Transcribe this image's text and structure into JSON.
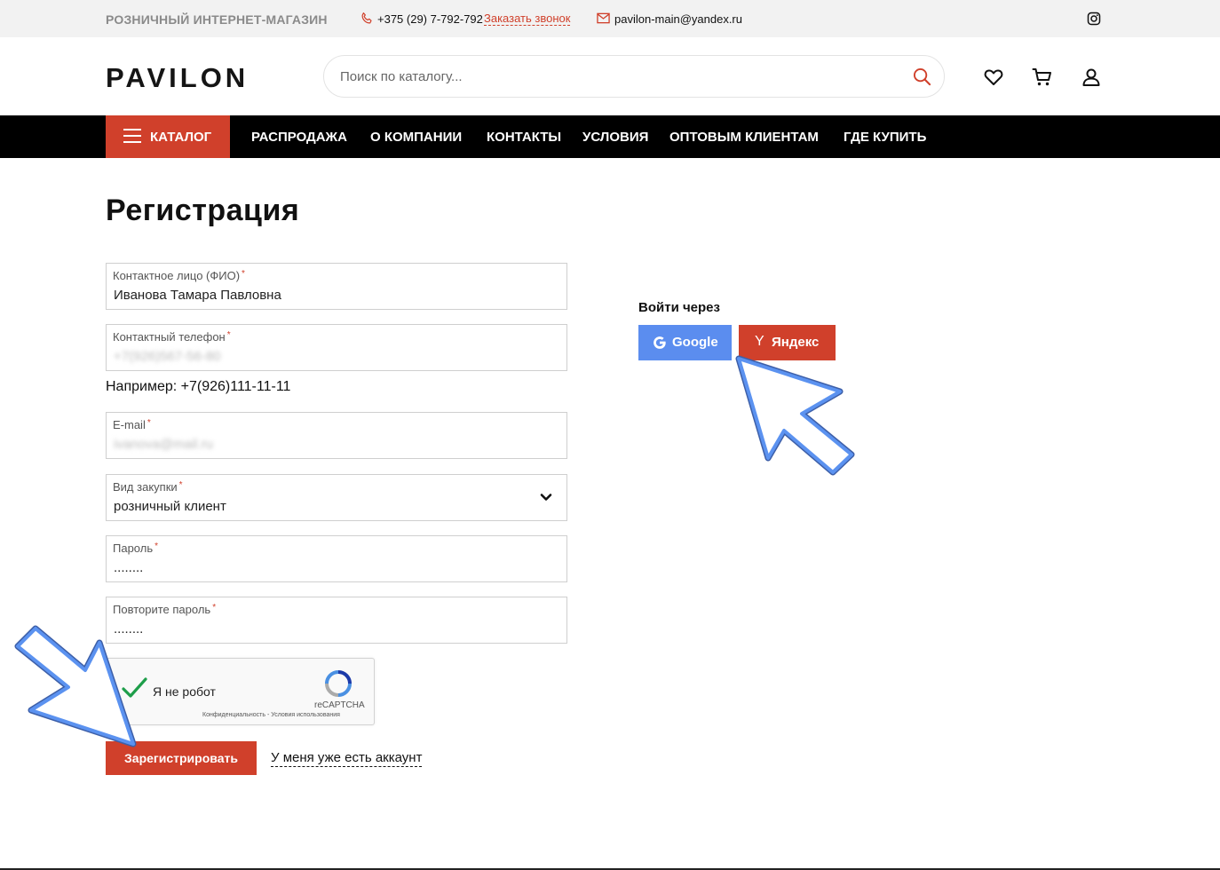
{
  "topbar": {
    "tagline": "РОЗНИЧНЫЙ ИНТЕРНЕТ-МАГАЗИН",
    "phone": "+375 (29) 7-792-792",
    "callback": "Заказать звонок",
    "email": "pavilon-main@yandex.ru",
    "social_icon": "instagram-icon"
  },
  "header": {
    "logo": "PAVILON",
    "search_placeholder": "Поиск по каталогу...",
    "icons": [
      "heart-icon",
      "cart-icon",
      "user-icon"
    ]
  },
  "nav": {
    "catalog": "КАТАЛОГ",
    "items": [
      "РАСПРОДАЖА",
      "О КОМПАНИИ",
      "КОНТАКТЫ",
      "УСЛОВИЯ",
      "ОПТОВЫМ КЛИЕНТАМ",
      "ГДЕ КУПИТЬ"
    ]
  },
  "page": {
    "title": "Регистрация"
  },
  "form": {
    "fields": [
      {
        "label": "Контактное лицо (ФИО)",
        "required": "*",
        "value": "Иванова Тамара Павловна"
      },
      {
        "label": "Контактный телефон",
        "required": "*",
        "value": "+7(926)567-56-80"
      },
      {
        "label": "E-mail",
        "required": "*",
        "value": "ivanova@mail.ru"
      },
      {
        "label": "Вид закупки",
        "required": "*",
        "value": "розничный клиент"
      },
      {
        "label": "Пароль",
        "required": "*",
        "value": "........"
      },
      {
        "label": "Повторите пароль",
        "required": "*",
        "value": "........"
      }
    ],
    "phone_hint": "Например: +7(926)111-11-11",
    "captcha": {
      "text": "Я не робот",
      "brand": "reCAPTCHA",
      "terms": "Конфиденциальность - Условия использования"
    },
    "register_label": "Зарегистрировать",
    "login_link": "У меня уже есть аккаунт"
  },
  "social": {
    "label": "Войти через",
    "google": "Google",
    "yandex": "Яндекс",
    "yandex_glyph": "Y"
  },
  "colors": {
    "accent": "#d0402b",
    "google": "#5b8def",
    "nav_bg": "#000000",
    "topbar_bg": "#f2f2f2",
    "annotation_arrow": "#4a86e8"
  }
}
